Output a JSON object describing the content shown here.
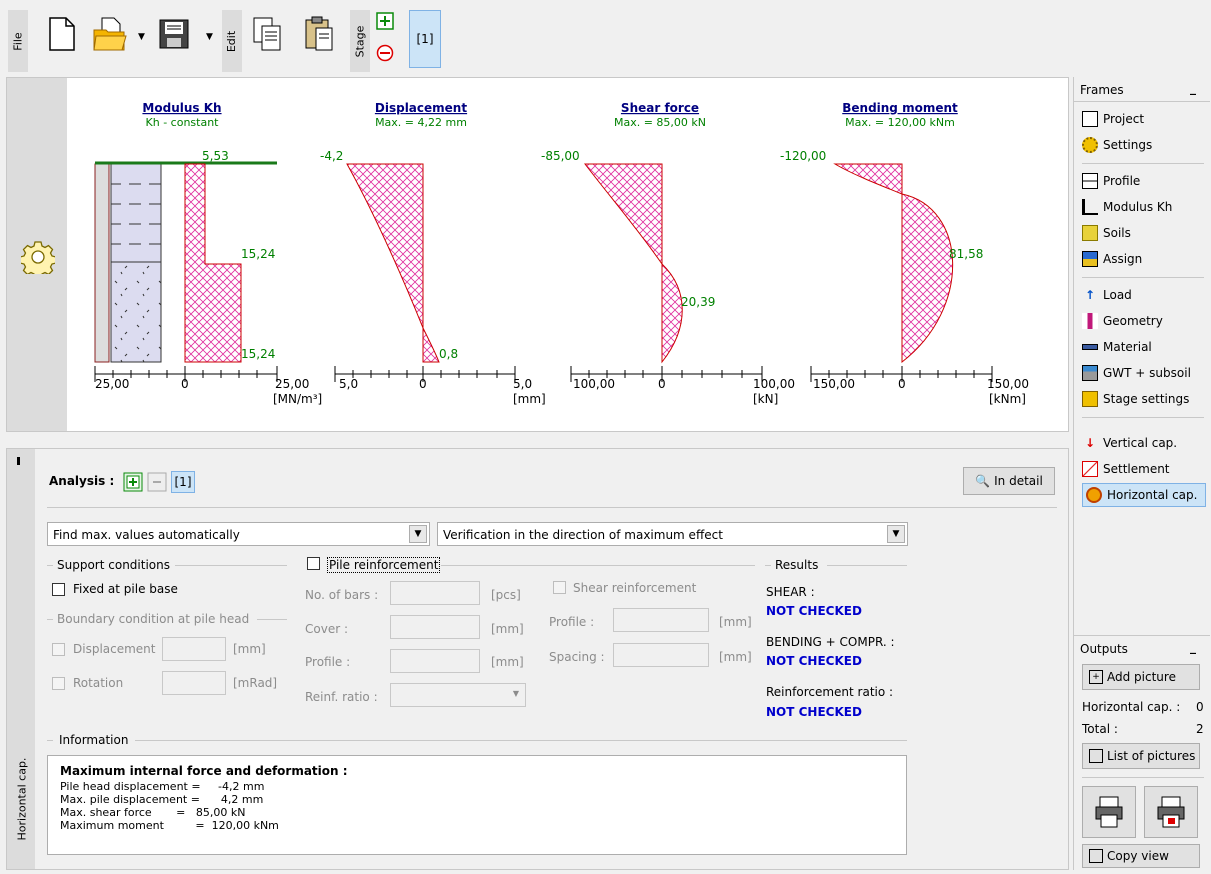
{
  "toolbar": {
    "file_label": "File",
    "edit_label": "Edit",
    "stage_label": "Stage",
    "stage_current": "[1]",
    "icons": [
      "new-file-icon",
      "open-folder-icon",
      "save-icon",
      "copy-icon",
      "paste-icon",
      "add-stage-icon",
      "remove-stage-icon"
    ]
  },
  "graphs": {
    "modulus": {
      "title": "Modulus Kh",
      "subtitle": "Kh - constant",
      "top_value": "5,53",
      "mid_value": "15,24",
      "bot_value": "15,24",
      "axis_left": "25,00",
      "axis_zero": "0",
      "axis_right": "25,00",
      "unit": "[MN/m³]"
    },
    "displacement": {
      "title": "Displacement",
      "subtitle": "Max. = 4,22 mm",
      "top_value": "-4,2",
      "bot_value": "0,8",
      "axis_left": "5,0",
      "axis_zero": "0",
      "axis_right": "5,0",
      "unit": "[mm]"
    },
    "shear": {
      "title": "Shear force",
      "subtitle": "Max. = 85,00 kN",
      "top_value": "-85,00",
      "mid_value": "20,39",
      "axis_left": "100,00",
      "axis_zero": "0",
      "axis_right": "100,00",
      "unit": "[kN]"
    },
    "moment": {
      "title": "Bending moment",
      "subtitle": "Max. = 120,00 kNm",
      "top_value": "-120,00",
      "mid_value": "81,58",
      "axis_left": "150,00",
      "axis_zero": "0",
      "axis_right": "150,00",
      "unit": "[kNm]"
    }
  },
  "analysis": {
    "side_label": "Horizontal cap.",
    "title": "Analysis :",
    "current": "[1]",
    "in_detail": "In detail",
    "dropdown1": "Find max. values automatically",
    "dropdown2": "Verification in the direction of maximum effect",
    "support_conditions": "Support conditions",
    "fixed_at_base": "Fixed at pile base",
    "boundary_head": "Boundary condition at pile head",
    "displacement": "Displacement",
    "displacement_unit": "[mm]",
    "rotation": "Rotation",
    "rotation_unit": "[mRad]",
    "pile_reinforcement": "Pile reinforcement",
    "no_of_bars": "No. of bars :",
    "bars_unit": "[pcs]",
    "cover": "Cover :",
    "cover_unit": "[mm]",
    "profile": "Profile :",
    "profile_unit": "[mm]",
    "reinf_ratio": "Reinf. ratio :",
    "shear_reinforcement": "Shear reinforcement",
    "shear_profile": "Profile :",
    "shear_profile_unit": "[mm]",
    "spacing": "Spacing :",
    "spacing_unit": "[mm]",
    "results": "Results",
    "shear_label": "SHEAR :",
    "shear_status": "NOT CHECKED",
    "bending_label": "BENDING + COMPR. :",
    "bending_status": "NOT CHECKED",
    "reinf_ratio_label": "Reinforcement ratio :",
    "reinf_ratio_status": "NOT CHECKED",
    "information": "Information",
    "info_title": "Maximum internal force and deformation :",
    "info_lines": [
      "Pile head displacement =     -4,2 mm",
      "Max. pile displacement =      4,2 mm",
      "Max. shear force       =   85,00 kN",
      "Maximum moment         =  120,00 kNm"
    ]
  },
  "frames": {
    "title": "Frames",
    "items": [
      {
        "label": "Project",
        "icon": "project-icon"
      },
      {
        "label": "Settings",
        "icon": "settings-gear-icon"
      },
      {
        "label": "Profile",
        "icon": "profile-icon"
      },
      {
        "label": "Modulus Kh",
        "icon": "modulus-icon"
      },
      {
        "label": "Soils",
        "icon": "soils-icon"
      },
      {
        "label": "Assign",
        "icon": "assign-icon"
      },
      {
        "label": "Load",
        "icon": "load-icon"
      },
      {
        "label": "Geometry",
        "icon": "geometry-icon"
      },
      {
        "label": "Material",
        "icon": "material-icon"
      },
      {
        "label": "GWT + subsoil",
        "icon": "gwt-icon"
      },
      {
        "label": "Stage settings",
        "icon": "stage-settings-icon"
      },
      {
        "label": "Vertical cap.",
        "icon": "vertical-cap-icon"
      },
      {
        "label": "Settlement",
        "icon": "settlement-icon"
      },
      {
        "label": "Horizontal cap.",
        "icon": "horizontal-cap-icon"
      }
    ],
    "selected": "Horizontal cap."
  },
  "outputs": {
    "title": "Outputs",
    "add_picture": "Add picture",
    "horizontal_cap_label": "Horizontal cap. :",
    "horizontal_cap_count": "0",
    "total_label": "Total :",
    "total_count": "2",
    "list_of_pictures": "List of pictures",
    "copy_view": "Copy view"
  },
  "colors": {
    "accent_blue": "#0000cc",
    "hatch_magenta": "#e0309e",
    "value_green": "#008000",
    "title_navy": "#000080",
    "selection_blue": "#cce4f7"
  }
}
